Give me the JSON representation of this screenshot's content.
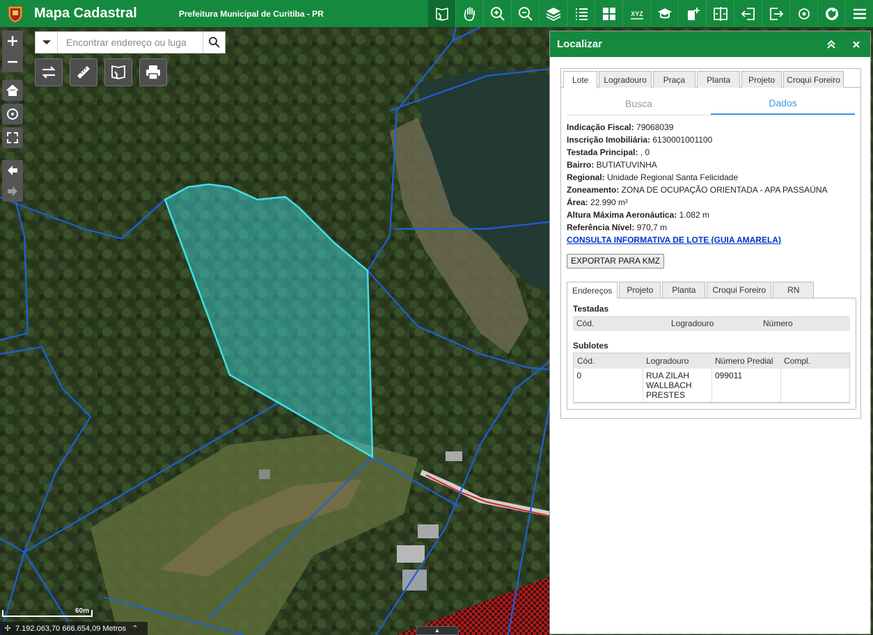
{
  "header": {
    "app_title": "Mapa Cadastral",
    "subtitle": "Prefeitura Municipal de Curitiba - PR"
  },
  "toolbar": {
    "icons": [
      "identify-icon",
      "pan-icon",
      "zoom-in-icon",
      "zoom-out-icon",
      "layers-icon",
      "legend-icon",
      "basemap-icon",
      "xyz-coordinate-icon",
      "education-icon",
      "add-data-icon",
      "swipe-icon",
      "import-icon",
      "export-icon",
      "location-icon",
      "map-settings-icon",
      "menu-icon"
    ],
    "xyz_label": "XYZ"
  },
  "search": {
    "placeholder": "Encontrar endereço ou luga"
  },
  "map": {
    "scale_label": "60m",
    "coordinates": "7.192.063,70 666.654,09 Metros"
  },
  "panel": {
    "title": "Localizar",
    "tabs": [
      "Lote",
      "Logradouro",
      "Praça",
      "Planta",
      "Projeto",
      "Croqui Foreiro"
    ],
    "active_tab": "Lote",
    "subtabs": [
      "Busca",
      "Dados"
    ],
    "active_subtab": "Dados",
    "fields": [
      {
        "label": "Indicação Fiscal:",
        "value": " 79068039"
      },
      {
        "label": "Inscrição Imobiliária:",
        "value": " 6130001001100"
      },
      {
        "label": "Testada Principal:",
        "value": " , 0"
      },
      {
        "label": "Bairro:",
        "value": " BUTIATUVINHA"
      },
      {
        "label": "Regional:",
        "value": " Unidade Regional Santa Felicidade"
      },
      {
        "label": "Zoneamento:",
        "value": " ZONA DE OCUPAÇÃO ORIENTADA - APA PASSAÚNA"
      },
      {
        "label": "Área:",
        "value": " 22.990 m²"
      },
      {
        "label": "Altura Máxima Aeronáutica:",
        "value": " 1.082 m"
      },
      {
        "label": "Referência Nível:",
        "value": " 970,7 m"
      }
    ],
    "link_text": "CONSULTA INFORMATIVA DE LOTE (GUIA AMARELA)",
    "export_label": "EXPORTAR PARA KMZ",
    "inner_tabs": [
      "Endereços",
      "Projeto",
      "Planta",
      "Croqui Foreiro",
      "RN"
    ],
    "active_inner_tab": "Endereços",
    "testadas": {
      "title": "Testadas",
      "headers": [
        "Cód.",
        "Logradouro",
        "Número"
      ],
      "rows": []
    },
    "sublotes": {
      "title": "Sublotes",
      "headers": [
        "Cód.",
        "Logradouro",
        "Número Predial",
        "Compl."
      ],
      "rows": [
        [
          "0",
          "RUA ZILAH WALLBACH PRESTES",
          "099011",
          ""
        ]
      ]
    }
  },
  "colors": {
    "brand_green": "#158a3f",
    "parcel_line": "#1e5fd8",
    "selected_parcel": "#3fe0e8",
    "link": "#0033cc",
    "active_subtab": "#3d9be9"
  }
}
